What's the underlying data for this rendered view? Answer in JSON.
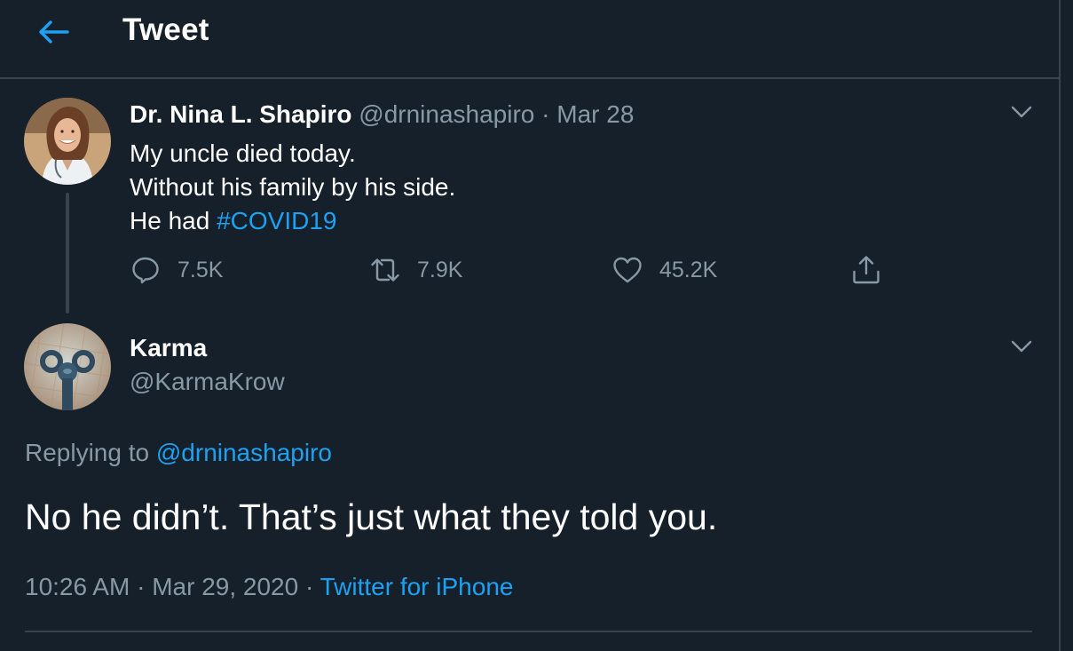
{
  "header": {
    "title": "Tweet"
  },
  "tweet1": {
    "display_name": "Dr. Nina L. Shapiro",
    "handle": "@drninashapiro",
    "separator": "·",
    "date": "Mar 28",
    "lines": [
      "My uncle died today.",
      "Without his family by his side.",
      "He had"
    ],
    "hashtag": "#COVID19",
    "stats": {
      "replies": "7.5K",
      "retweets": "7.9K",
      "likes": "45.2K"
    }
  },
  "tweet2": {
    "display_name": "Karma",
    "handle": "@KarmaKrow",
    "replying_prefix": "Replying to",
    "replying_handle": "@drninashapiro",
    "text": "No he didn’t. That’s just what they told you.",
    "time": "10:26 AM",
    "date": "Mar 29, 2020",
    "source": "Twitter for iPhone",
    "separator": "·"
  },
  "colors": {
    "background": "#15202b",
    "border": "#38444d",
    "accent": "#1da1f2",
    "muted_text": "#8899a6",
    "text": "#ffffff"
  },
  "icons": {
    "back": "arrow-left-icon",
    "more": "chevron-down-icon",
    "reply": "reply-bubble-icon",
    "retweet": "retweet-icon",
    "like": "heart-icon",
    "share": "share-icon"
  }
}
